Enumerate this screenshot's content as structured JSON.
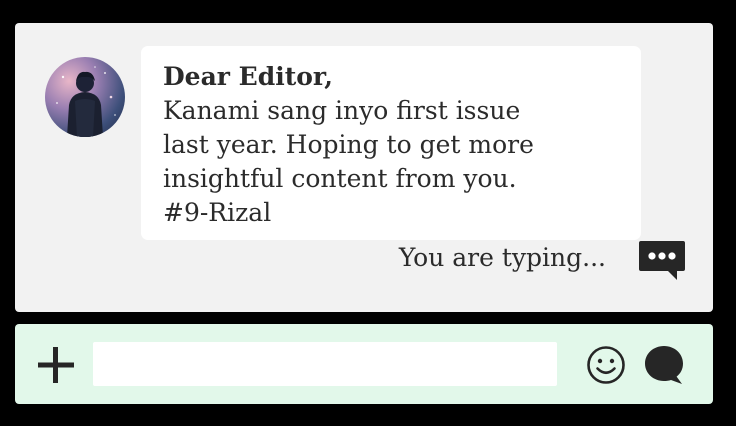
{
  "message": {
    "title": "Dear Editor,",
    "body_lines": [
      "Kanami sang inyo first issue",
      "last year. Hoping to get more",
      "insightful content from you.",
      "#9-Rizal"
    ]
  },
  "status": {
    "typing_text": "You are typing..."
  },
  "composer": {
    "value": "",
    "placeholder": ""
  },
  "icons": {
    "avatar": "avatar-image",
    "typing": "chat-bubble-dots-icon",
    "add": "plus-icon",
    "emoji": "smiley-icon",
    "send": "speech-bubble-icon"
  },
  "colors": {
    "chat_background": "#f2f2f2",
    "bubble_background": "#ffffff",
    "input_bar_background": "#e2f8ea",
    "icon_color": "#262626"
  }
}
